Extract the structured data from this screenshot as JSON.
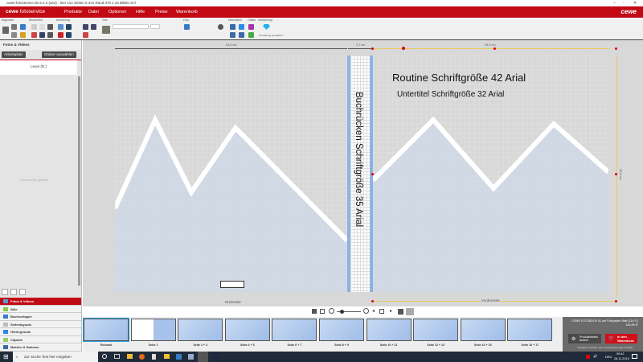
{
  "window": {
    "title": "cewe-fotoservice.de 6.4.4 (x64) - leer 114 Seiten 6 mm Rand 370 x 23 Bilder.mcf",
    "minimize": "–",
    "maximize": "▫",
    "close": "✕"
  },
  "menu": {
    "logo_bold": "cewe",
    "logo_rest": " fotoservice",
    "items": [
      "Produkte",
      "Datei",
      "Optionen",
      "Hilfe",
      "Preise",
      "Warenkorb"
    ],
    "brand": "cewe"
  },
  "toolbar": {
    "groups": [
      "Allgemein",
      "Bearbeiten",
      "Anordnung",
      "Text",
      "Foto",
      "Dekoration",
      "Online",
      "Veredelung"
    ],
    "veredelung_label": "Veredelung auswählen"
  },
  "leftpanel": {
    "title": "Fotos & Videos",
    "workspace_button": "Arbeitsplatz",
    "folder_button": "Ordner auswählen",
    "drive": "Lexar (D:)",
    "empty_msg": "Fotos werden geladen",
    "sections": [
      "Fotos & Videos",
      "Stile",
      "Buchvorlagen",
      "Seitenlayouts",
      "Hintergründe",
      "Cliparts",
      "Masken & Rahmen"
    ]
  },
  "canvas": {
    "ruler_left": "29,5 cm",
    "ruler_spine": "2,7 cm",
    "ruler_right": "29,5 cm",
    "ruler_height": "29,8 cm",
    "title_text": "Routine Schriftgröße 42 Arial",
    "subtitle_text": "Untertitel Schriftgröße 32 Arial",
    "spine_text": "Buchrücken Schriftgröße 35 Arial",
    "back_label": "Rückseite",
    "front_label": "Vorderseite"
  },
  "thumbnails": [
    "Einband",
    "Seite 1",
    "Seite 2 + 3",
    "Seite 4 + 5",
    "Seite 6 + 7",
    "Seite 8 + 9",
    "Seite 10 + 11",
    "Seite 12 + 13",
    "Seite 14 + 15",
    "Seite 16 + 17"
  ],
  "product": {
    "name": "CEWE FOTOBUCH XL auf Fotopapier Matt (114 S.)",
    "price": "160,55 €*",
    "details_button": "Produktdetails ändern",
    "cart_button": "In den Warenkorb",
    "note": "*Verfügbar mit Mwst. zzgl. Versandkosten ggfs. Rabatte"
  },
  "taskbar": {
    "search_placeholder": "Zur Suche Text hier eingeben",
    "lang": "DEU",
    "time": "09:42",
    "date": "28.11.2019"
  },
  "colors": {
    "brand_red": "#c20a15",
    "page_blue": "#a3c0ea"
  }
}
